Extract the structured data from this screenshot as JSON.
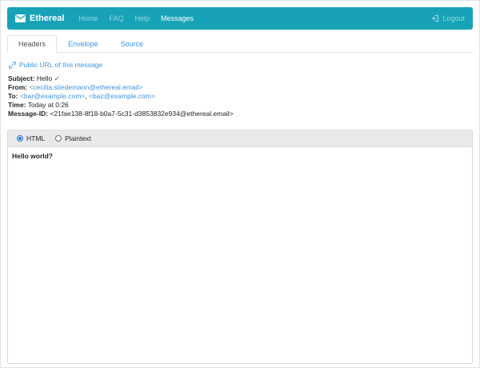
{
  "navbar": {
    "brand": "Ethereal",
    "items": [
      {
        "label": "Home",
        "active": false
      },
      {
        "label": "FAQ",
        "active": false
      },
      {
        "label": "Help",
        "active": false
      },
      {
        "label": "Messages",
        "active": true
      }
    ],
    "logout_label": "Logout"
  },
  "tabs": [
    {
      "label": "Headers",
      "active": true
    },
    {
      "label": "Envelope",
      "active": false
    },
    {
      "label": "Source",
      "active": false
    }
  ],
  "public_url_label": "Public URL of this message",
  "headers": {
    "subject_label": "Subject:",
    "subject_value": "Hello",
    "subject_check": "✓",
    "from_label": "From:",
    "from_value": "<cecilia.stiedemann@ethereal.email>",
    "to_label": "To:",
    "to_values": [
      "<bar@example.com>",
      "<baz@example.com>"
    ],
    "to_separator": ", ",
    "time_label": "Time:",
    "time_value": "Today at 0:26",
    "message_id_label": "Message-ID:",
    "message_id_value": "<21fae138-8f18-b0a7-5c31-d3853832e934@ethereal.email>"
  },
  "viewer": {
    "html_option": "HTML",
    "plaintext_option": "Plaintext",
    "selected": "HTML",
    "body_text": "Hello world?"
  },
  "icons": {
    "brand": "envelope-icon",
    "logout": "logout-icon",
    "public_url": "link-icon",
    "subject_status": "check-mark"
  },
  "colors": {
    "navbar": "#17a2b8",
    "link": "#3e95e5",
    "radio_accent": "#2470cf",
    "text": "#212529",
    "card_header_bg": "#e9e9e9"
  }
}
